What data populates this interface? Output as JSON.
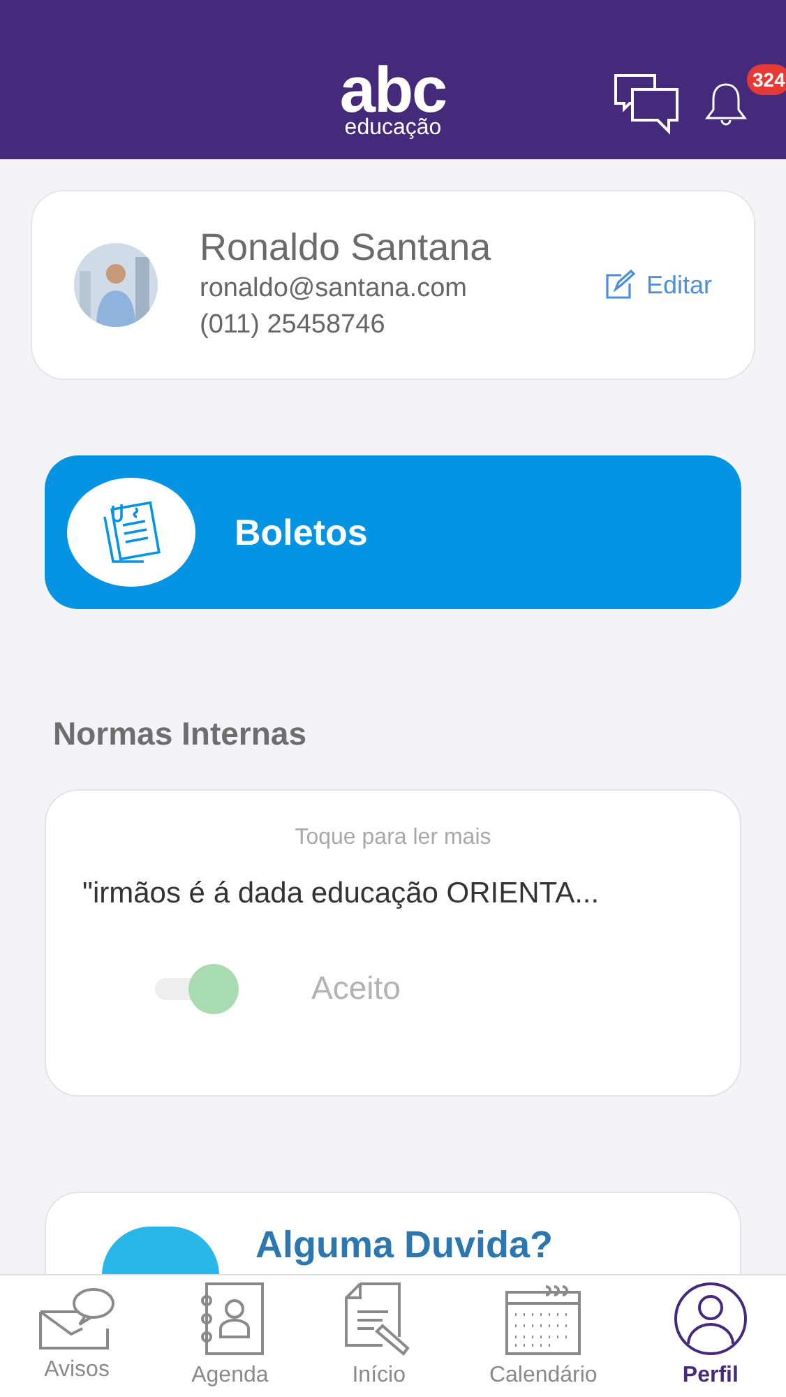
{
  "header": {
    "logo": "abc",
    "logo_subtitle": "educação",
    "notifications_badge": "324"
  },
  "profile": {
    "name": "Ronaldo Santana",
    "email": "ronaldo@santana.com",
    "phone": "(011) 25458746",
    "edit_label": "Editar"
  },
  "boletos": {
    "label": "Boletos"
  },
  "section_title": "Normas Internas",
  "norms": {
    "hint": "Toque para ler mais",
    "excerpt": "\"irmãos é á dada educação ORIENTA...",
    "accepted": true,
    "accept_label": "Aceito"
  },
  "help": {
    "title": "Alguma Duvida?"
  },
  "tabs": [
    {
      "label": "Avisos",
      "selected": false
    },
    {
      "label": "Agenda",
      "selected": false
    },
    {
      "label": "Início",
      "selected": false
    },
    {
      "label": "Calendário",
      "selected": false
    },
    {
      "label": "Perfil",
      "selected": true
    }
  ]
}
